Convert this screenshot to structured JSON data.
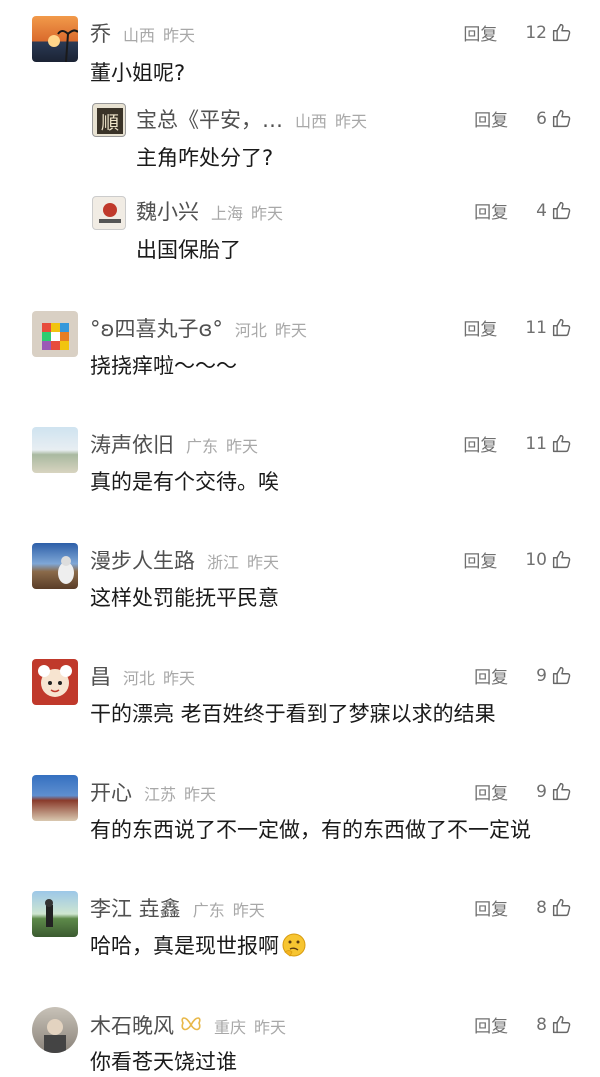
{
  "ui": {
    "reply_label": "回复",
    "thumb_icon": "thumbs-up-icon"
  },
  "comments": [
    {
      "name": "乔",
      "region": "山西",
      "time": "昨天",
      "likes": "12",
      "text": "董小姐呢?",
      "replies": [
        {
          "name": "宝总《平安，…",
          "region": "山西",
          "time": "昨天",
          "likes": "6",
          "text": "主角咋处分了?"
        },
        {
          "name": "魏小兴",
          "region": "上海",
          "time": "昨天",
          "likes": "4",
          "text": "出国保胎了"
        }
      ]
    },
    {
      "name": "°ʚ四喜丸子ɞ°",
      "region": "河北",
      "time": "昨天",
      "likes": "11",
      "text": "挠挠痒啦～～～"
    },
    {
      "name": "涛声依旧",
      "region": "广东",
      "time": "昨天",
      "likes": "11",
      "text": "真的是有个交待。唉"
    },
    {
      "name": "漫步人生路",
      "region": "浙江",
      "time": "昨天",
      "likes": "10",
      "text": "这样处罚能抚平民意"
    },
    {
      "name": "昌",
      "region": "河北",
      "time": "昨天",
      "likes": "9",
      "text": "干的漂亮 老百姓终于看到了梦寐以求的结果"
    },
    {
      "name": "开心",
      "region": "江苏",
      "time": "昨天",
      "likes": "9",
      "text": "有的东西说了不一定做，有的东西做了不一定说"
    },
    {
      "name": "李江 垚鑫",
      "region": "广东",
      "time": "昨天",
      "likes": "8",
      "text": "哈哈，真是现世报啊",
      "emoji": "thinking-face-icon"
    },
    {
      "name": "木石晚风",
      "region": "重庆",
      "time": "昨天",
      "likes": "8",
      "text": "你看苍天饶过谁",
      "badge": "butterfly-icon"
    }
  ]
}
